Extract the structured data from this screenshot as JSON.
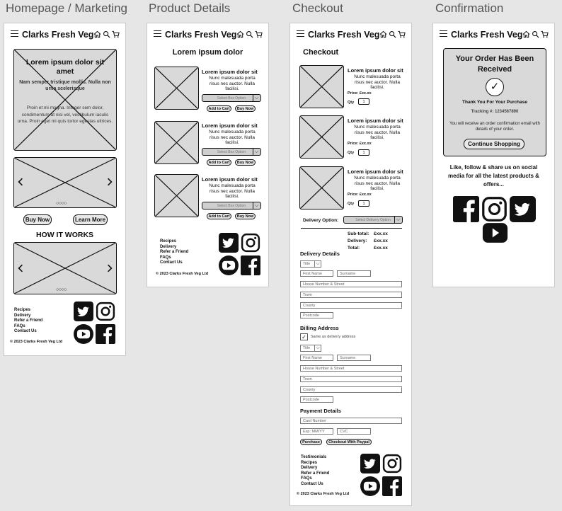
{
  "labels": {
    "homepage": "Homepage / Marketing",
    "product": "Product Details",
    "checkout": "Checkout",
    "confirmation": "Confirmation"
  },
  "brand": "Clarks Fresh Veg",
  "footer": {
    "links_short": [
      "Recipes",
      "Delivery",
      "Refer a Friend",
      "FAQs",
      "Contact Us"
    ],
    "links_checkout": [
      "Testimonials",
      "Recipes",
      "Delivery",
      "Refer a Friend",
      "FAQs",
      "Contact Us"
    ],
    "copyright": "© 2023 Clarks Fresh Veg Ltd"
  },
  "home": {
    "hero_title": "Lorem ipsum dolor sit amet",
    "hero_sub": "Nam semper tristique mollis. Nulla non urna scelerisque",
    "hero_body": "Proin et mi magna. Integer sem dolor, condimentum at nisi vel, vestibulum iaculis urna. Proin eget mi quis tortor egestas ultrices.",
    "buy_now": "Buy Now",
    "learn_more": "Learn More",
    "how_it_works": "HOW IT WORKS"
  },
  "product": {
    "title": "Lorem ipsum dolor",
    "items": [
      {
        "name": "Lorem ipsum dolor sit",
        "desc": "Nunc malesuada porta risus nec auctor. Nulla facilisi.",
        "select": "Select Box Option",
        "add": "Add to Cart",
        "buy": "Buy Now"
      },
      {
        "name": "Lorem ipsum dolor sit",
        "desc": "Nunc malesuada porta risus nec auctor. Nulla facilisi.",
        "select": "Select Box Option",
        "add": "Add to Cart",
        "buy": "Buy Now"
      },
      {
        "name": "Lorem ipsum dolor sit",
        "desc": "Nunc malesuada porta risus nec auctor. Nulla facilisi.",
        "select": "Select Box Option",
        "add": "Add to Cart",
        "buy": "Buy Now"
      }
    ]
  },
  "checkout": {
    "title": "Checkout",
    "items": [
      {
        "name": "Lorem ipsum dolor sit",
        "desc": "Nunc malesuada porta risus nec auctor. Nulla facilisi.",
        "price": "Price: £xx.xx",
        "qty_label": "Qty",
        "qty": "1"
      },
      {
        "name": "Lorem ipsum dolor sit",
        "desc": "Nunc malesuada porta risus nec auctor. Nulla facilisi.",
        "price": "Price: £xx.xx",
        "qty_label": "Qty",
        "qty": "1"
      },
      {
        "name": "Lorem ipsum dolor sit",
        "desc": "Nunc malesuada porta risus nec auctor. Nulla facilisi.",
        "price": "Price: £xx.xx",
        "qty_label": "Qty",
        "qty": "1"
      }
    ],
    "delivery_option_label": "Delivery Option:",
    "delivery_option_placeholder": "Select Delivery Option",
    "subtotal_label": "Sub-total:",
    "subtotal": "£xx.xx",
    "delivery_label": "Delivery:",
    "delivery": "£xx.xx",
    "total_label": "Total:",
    "total": "£xx.xx",
    "delivery_details": "Delivery Details",
    "billing_address": "Billing Address",
    "same_as_delivery": "Same as delivery address",
    "payment_details": "Payment Details",
    "ph_title": "Title",
    "ph_first": "First Name",
    "ph_surname": "Surname",
    "ph_house": "House Number & Street",
    "ph_town": "Town",
    "ph_county": "County",
    "ph_postcode": "Postcode",
    "ph_card": "Card Number",
    "ph_exp": "Exp: MM/YY",
    "ph_cvc": "CVC",
    "purchase": "Purchase",
    "paypal": "Checkout With Paypal"
  },
  "confirmation": {
    "title": "Your Order Has Been Received",
    "check": "✓",
    "thanks": "Thank You For Your Purchase",
    "tracking": "Tracking #: 1234567890",
    "email_note": "You will receive an order confirmation email with details of your order.",
    "continue": "Continue Shopping",
    "social_text": "Like, follow & share us on social media for all the latest products & offers..."
  }
}
